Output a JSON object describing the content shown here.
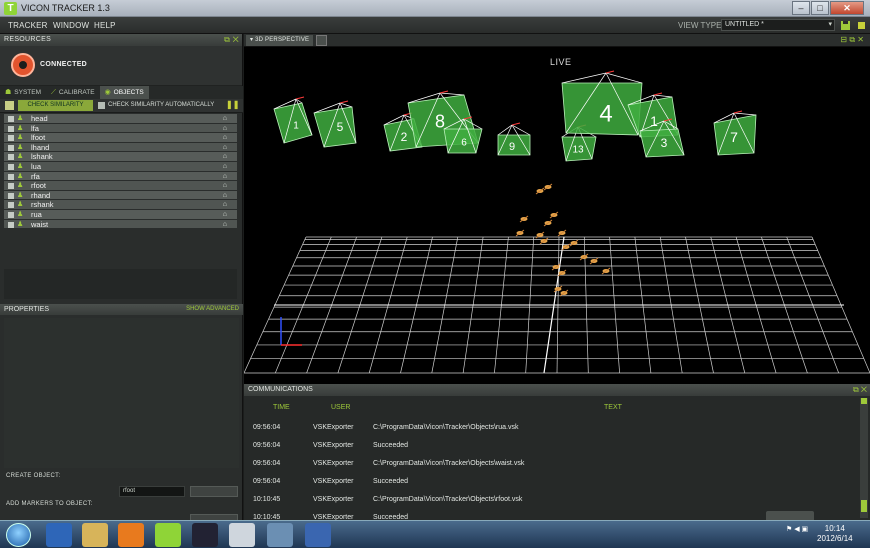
{
  "window": {
    "title": "VICON TRACKER 1.3",
    "app_icon_glyph": "T"
  },
  "menu": {
    "items": [
      "TRACKER",
      "WINDOW",
      "HELP"
    ],
    "view_type_label": "VIEW TYPE:",
    "view_type_value": "UNTITLED *"
  },
  "resources": {
    "header": "RESOURCES",
    "status": "CONNECTED",
    "tabs": [
      "SYSTEM",
      "CALIBRATE",
      "OBJECTS"
    ],
    "active_tab": "OBJECTS",
    "check_similarity_button": "CHECK SIMILARITY",
    "check_auto_label": "CHECK SIMILARITY AUTOMATICALLY",
    "objects": [
      "head",
      "lfa",
      "lfoot",
      "lhand",
      "lshank",
      "lua",
      "rfa",
      "rfoot",
      "rhand",
      "rshank",
      "rua",
      "waist"
    ]
  },
  "properties": {
    "header": "PROPERTIES",
    "show_advanced": "SHOW ADVANCED"
  },
  "create": {
    "create_label": "CREATE OBJECT:",
    "object_name_value": "rfoot",
    "add_markers_label": "ADD MARKERS TO OBJECT:"
  },
  "viewport": {
    "tab_label": "3D PERSPECTIVE",
    "live_label": "LIVE",
    "object_numbers": [
      "1",
      "5",
      "2",
      "8",
      "6",
      "9",
      "13",
      "4",
      "1",
      "3",
      "7"
    ]
  },
  "communications": {
    "header": "COMMUNICATIONS",
    "columns": [
      "TIME",
      "USER",
      "TEXT"
    ],
    "rows": [
      {
        "time": "09:56:04",
        "user": "VSKExporter",
        "text": "C:\\ProgramData\\Vicon\\Tracker\\Objects\\rua.vsk"
      },
      {
        "time": "09:56:04",
        "user": "VSKExporter",
        "text": "Succeeded"
      },
      {
        "time": "09:56:04",
        "user": "VSKExporter",
        "text": "C:\\ProgramData\\Vicon\\Tracker\\Objects\\waist.vsk"
      },
      {
        "time": "09:56:04",
        "user": "VSKExporter",
        "text": "Succeeded"
      },
      {
        "time": "10:10:45",
        "user": "VSKExporter",
        "text": "C:\\ProgramData\\Vicon\\Tracker\\Objects\\rfoot.vsk"
      },
      {
        "time": "10:10:45",
        "user": "VSKExporter",
        "text": "Succeeded"
      }
    ]
  },
  "taskbar": {
    "time": "10:14",
    "date": "2012/6/14"
  },
  "colors": {
    "accent": "#9ec93a",
    "object_green": "#3fae3f",
    "connected_red": "#e2542e"
  }
}
